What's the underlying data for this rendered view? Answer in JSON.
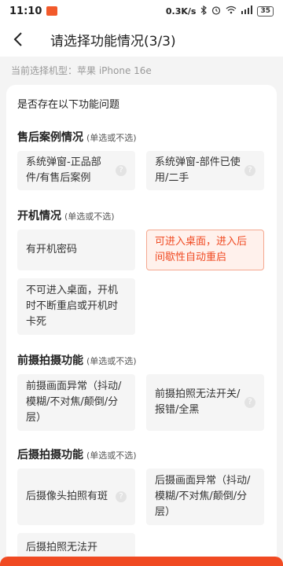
{
  "status_bar": {
    "time": "11:10",
    "network_speed": "0.3K/s",
    "battery": "35",
    "icons": [
      "bluetooth-icon",
      "alarm-icon",
      "wifi-icon",
      "signal-icon",
      "battery-icon"
    ]
  },
  "nav": {
    "back_icon": "chevron-left-icon",
    "title": "请选择功能情况(3/3)"
  },
  "model_info": "当前选择机型：苹果 iPhone 16e",
  "question": "是否存在以下功能问题",
  "colors": {
    "accent": "#f04a22",
    "selected_bg": "#fff1ec",
    "selected_border": "#f5a890"
  },
  "sections": [
    {
      "title": "售后案例情况",
      "hint": "(单选或不选)",
      "options": [
        {
          "label": "系统弹窗-正品部件/有售后案例",
          "selected": false,
          "has_help": true
        },
        {
          "label": "系统弹窗-部件已使用/二手",
          "selected": false,
          "has_help": true
        }
      ]
    },
    {
      "title": "开机情况",
      "hint": "(单选或不选)",
      "options": [
        {
          "label": "有开机密码",
          "selected": false,
          "has_help": false
        },
        {
          "label": "可进入桌面，进入后间歇性自动重启",
          "selected": true,
          "has_help": false
        },
        {
          "label": "不可进入桌面，开机时不断重启或开机时卡死",
          "selected": false,
          "has_help": false
        }
      ]
    },
    {
      "title": "前摄拍摄功能",
      "hint": "(单选或不选)",
      "options": [
        {
          "label": "前摄画面异常（抖动/模糊/不对焦/颠倒/分层）",
          "selected": false,
          "has_help": false
        },
        {
          "label": "前摄拍照无法开关/报错/全黑",
          "selected": false,
          "has_help": true
        }
      ]
    },
    {
      "title": "后摄拍摄功能",
      "hint": "(单选或不选)",
      "options": [
        {
          "label": "后摄像头拍照有斑",
          "selected": false,
          "has_help": true
        },
        {
          "label": "后摄画面异常（抖动/模糊/不对焦/颠倒/分层）",
          "selected": false,
          "has_help": false
        },
        {
          "label": "后摄拍照无法开",
          "selected": false,
          "has_help": false
        }
      ]
    }
  ]
}
